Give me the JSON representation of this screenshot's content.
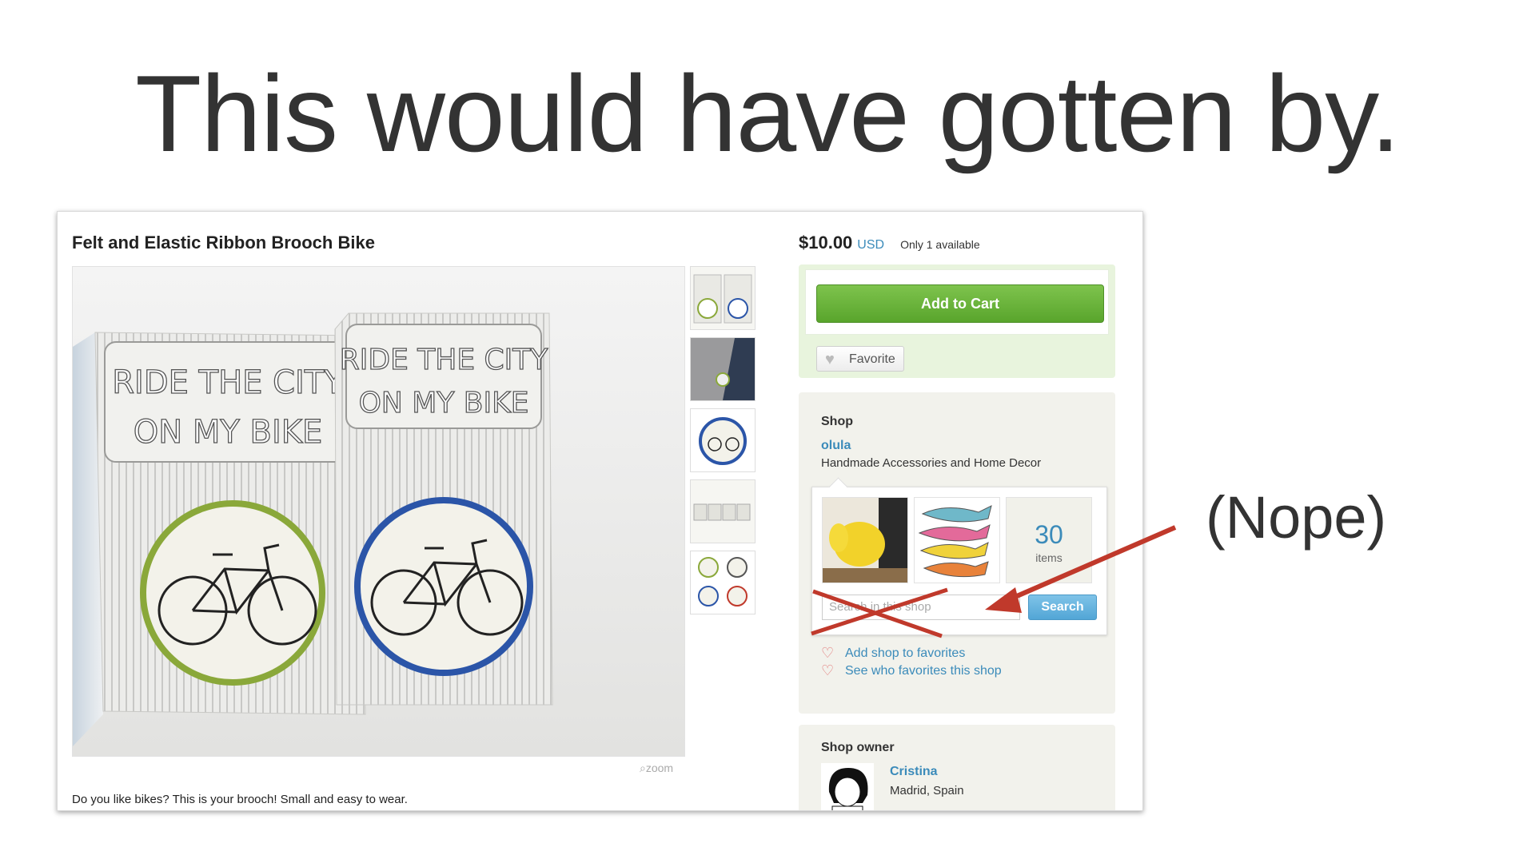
{
  "slide": {
    "title": "This would have gotten by.",
    "annotation": "(Nope)"
  },
  "listing": {
    "title": "Felt and Elastic Ribbon Brooch Bike",
    "zoom_label": "zoom",
    "description": "Do you like bikes? This is your brooch! Small and easy to wear.",
    "card_text_line1": "RIDE THE CITY",
    "card_text_line2": "ON MY BIKE",
    "thumbnail_count": 5
  },
  "purchase": {
    "price": "$10.00",
    "currency": "USD",
    "availability": "Only 1 available",
    "add_to_cart": "Add to Cart",
    "favorite": "Favorite"
  },
  "shop": {
    "label": "Shop",
    "name": "olula",
    "tagline": "Handmade Accessories and Home Decor",
    "item_count": "30",
    "item_count_label": "items",
    "search_placeholder": "Search in this shop",
    "search_button": "Search",
    "add_favorites": "Add shop to favorites",
    "see_favorites": "See who favorites this shop"
  },
  "owner": {
    "label": "Shop owner",
    "name": "Cristina",
    "location": "Madrid, Spain"
  },
  "colors": {
    "link_blue": "#3b8bba",
    "cart_green": "#6ab43f",
    "annotation_red": "#c0392b"
  }
}
